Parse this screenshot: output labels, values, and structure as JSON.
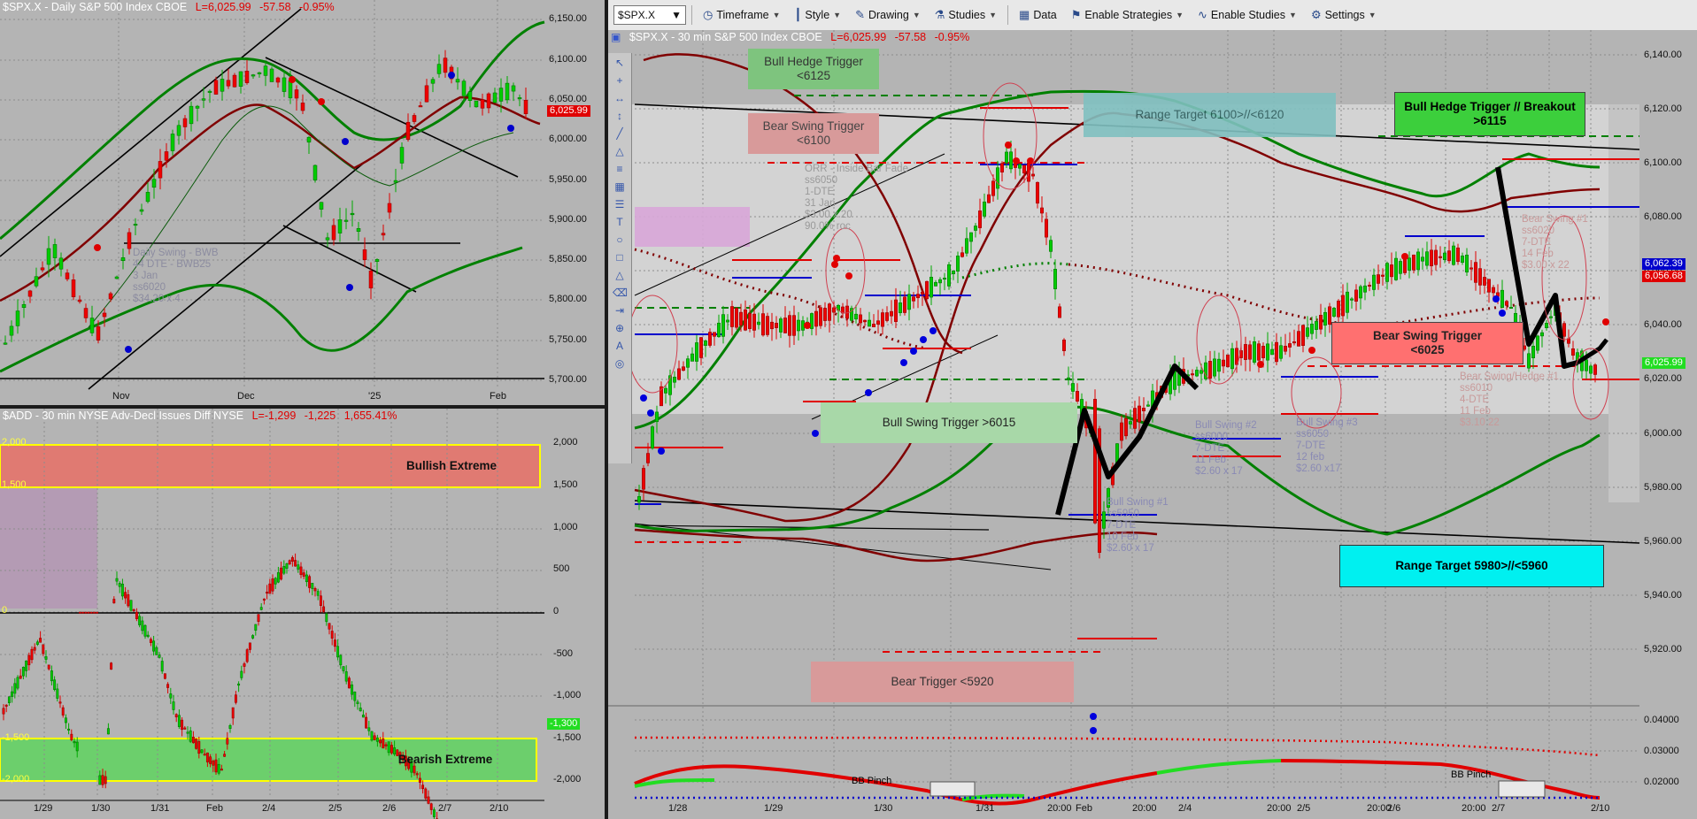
{
  "top_left": {
    "header": {
      "symbol": "$SPX.X - Daily  S&P 500 Index  CBOE",
      "last": "L=6,025.99",
      "change": "-57.58",
      "pct": "-0.95%"
    },
    "price_labels": [
      "6,150.00",
      "6,100.00",
      "6,050.00",
      "6,000.00",
      "5,950.00",
      "5,900.00",
      "5,850.00",
      "5,800.00",
      "5,750.00",
      "5,700.00"
    ],
    "last_price_tag": "6,025.99",
    "date_labels": [
      "Nov",
      "Dec",
      "'25",
      "Feb"
    ],
    "note": "Daily Swing - BWB\n44 DTE - BWB25\n3 Jan\nss6020\n$34.20 x 4",
    "colors": {
      "bg": "#b4b4b4",
      "band": "#008000",
      "mid": "#800000"
    }
  },
  "bottom_left": {
    "header": {
      "symbol": "$ADD - 30 min  NYSE Adv-Decl Issues Diff  NYSE",
      "last": "L=-1,299",
      "change": "-1,225",
      "pct": "1,655.41%"
    },
    "value_labels": [
      "2,000",
      "1,500",
      "1,000",
      "500",
      "0",
      "-500",
      "-1,000",
      "-1,500",
      "-2,000"
    ],
    "left_labels": [
      "2,000",
      "1,500",
      "0",
      "-1,500",
      "-2,000"
    ],
    "last_tag": "-1,300",
    "date_labels": [
      "1/29",
      "1/30",
      "1/31",
      "Feb",
      "2/4",
      "2/5",
      "2/6",
      "2/7",
      "2/10"
    ],
    "bullish_label": "Bullish Extreme",
    "bearish_label": "Bearish Extreme"
  },
  "right": {
    "toolbar": {
      "symbol": "$SPX.X",
      "items": [
        "Timeframe",
        "Style",
        "Drawing",
        "Studies",
        "Data",
        "Enable Strategies",
        "Enable Studies",
        "Settings"
      ]
    },
    "header": {
      "symbol": "$SPX.X - 30 min  S&P 500 Index  CBOE",
      "last": "L=6,025.99",
      "change": "-57.58",
      "pct": "-0.95%"
    },
    "price_labels": [
      "6,140.00",
      "6,120.00",
      "6,100.00",
      "6,080.00",
      "6,060.00",
      "6,040.00",
      "6,020.00",
      "6,000.00",
      "5,980.00",
      "5,960.00",
      "5,940.00",
      "5,920.00"
    ],
    "price_tags": [
      "6,062.39",
      "6,056.68",
      "6,025.99"
    ],
    "indicator_labels": [
      "0.04000",
      "0.03000",
      "0.02000"
    ],
    "date_labels": [
      "1/28",
      "1/29",
      "1/30",
      "1/31",
      "20:00",
      "Feb",
      "20:00",
      "2/4",
      "20:00",
      "2/5",
      "20:00",
      "2/6",
      "20:00",
      "2/7",
      "2/10"
    ],
    "boxes": {
      "bull_hedge": "Bull Hedge Trigger <6125",
      "bear_swing": "Bear Swing Trigger <6100",
      "range_top": "Range Target 6100>//<6120",
      "bull_hedge_breakout": "Bull Hedge Trigger // Breakout\n>6115",
      "bull_swing": "Bull Swing Trigger >6015",
      "bear_swing_2": "Bear Swing Trigger\n<6025",
      "range_bottom": "Range Target 5980>//<5960",
      "bear_trigger": "Bear Trigger <5920"
    },
    "notes": {
      "orr": "ORR - Inside Bar Fade\nss6050\n1-DTE\n31 Jan\n$3.00 x 20\n90.0% roc",
      "bull_swing_1": "Bull Swing #1\nss5950\n7-DTE\n10 Feb\n$2.60 x 17",
      "bull_swing_2": "Bull Swing #2\nss6000\n7-DTE\n11 Feb\n$2.60 x 17",
      "bull_swing_3": "Bull Swing #3\nss6050\n7-DTE\n12 feb\n$2.60 x17",
      "bear_swing_1": "Bear Swing #1\nss6020\n7-DTE\n14 Feb\n$3.00 x 22",
      "bear_hedge": "Bear Swing/Hedge #1\nss6010\n4-DTE\n11 Feb\n$3.10 22"
    },
    "bb_pinch": "BB Pinch"
  }
}
